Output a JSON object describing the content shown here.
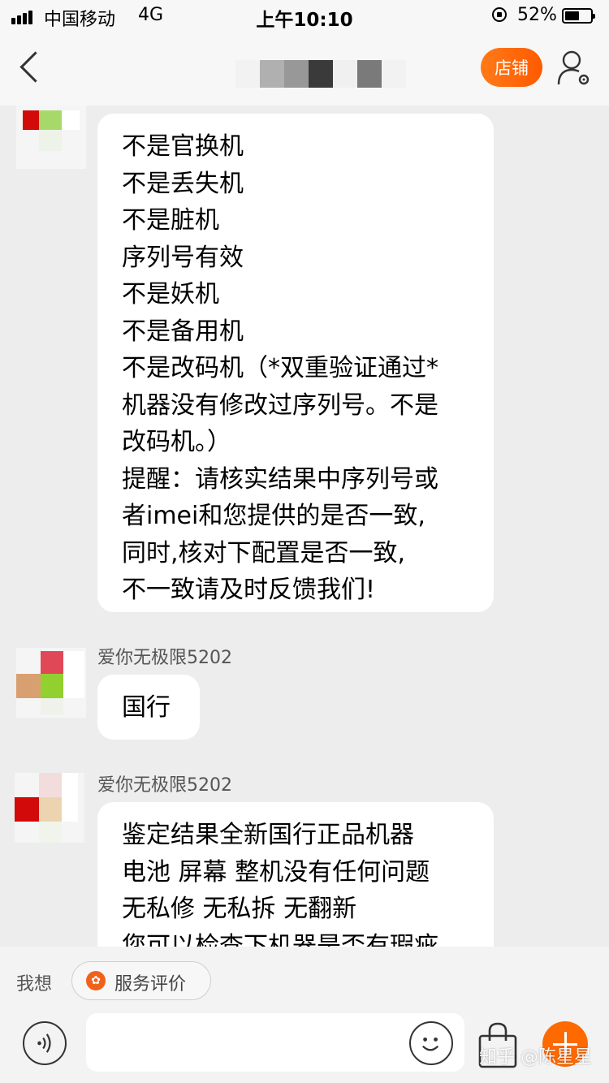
{
  "status_bar": {
    "carrier": "中国移动",
    "network": "4G",
    "time": "上午10:10",
    "battery_percent": "52%",
    "battery_level": 0.52
  },
  "nav": {
    "back_icon": "chevron-left-icon",
    "store_button": "店铺",
    "user_icon": "user-settings-icon"
  },
  "messages": [
    {
      "sender": "",
      "lines": [
        "不是官换机",
        "不是丢失机",
        "不是脏机",
        "序列号有效",
        "不是妖机",
        "不是备用机",
        "不是改码机（*双重验证通过*",
        "机器没有修改过序列号。不是",
        "改码机。）",
        "提醒：请核实结果中序列号或",
        "者imei和您提供的是否一致,",
        "同时,核对下配置是否一致,",
        "不一致请及时反馈我们!"
      ]
    },
    {
      "sender": "爱你无极限5202",
      "lines": [
        "国行"
      ]
    },
    {
      "sender": "爱你无极限5202",
      "lines": [
        "鉴定结果全新国行正品机器",
        "电池 屏幕 整机没有任何问题",
        "无私修 无私拆  无翻新",
        "您可以检查下机器是否有瑕疵"
      ]
    }
  ],
  "quick_bar": {
    "label": "我想",
    "service_button": "服务评价",
    "service_icon": "flower-icon"
  },
  "input_bar": {
    "voice_icon": "voice-icon",
    "emoji_icon": "emoji-icon",
    "bag_icon": "shopping-bag-icon",
    "plus_icon": "plus-icon"
  },
  "watermark": "知乎 @陈星星",
  "colors": {
    "accent": "#ff6a00",
    "background": "#ededed",
    "bubble": "#ffffff"
  }
}
